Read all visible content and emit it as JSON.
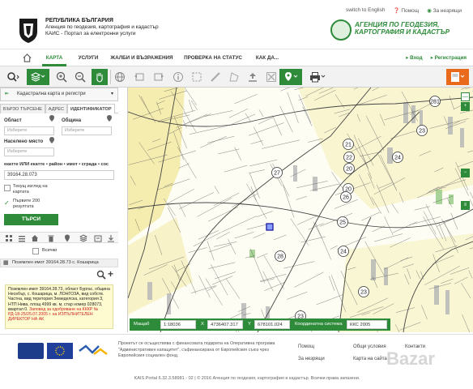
{
  "header": {
    "agency_line1": "РЕПУБЛИКА БЪЛГАРИЯ",
    "agency_line2": "Агенция по геодезия, картография и кадастър",
    "agency_line3": "КАИС - Портал за електронни услуги",
    "top_links": [
      "switch to English",
      "Помощ",
      "За незрящи"
    ],
    "logo_line1": "АГЕНЦИЯ ПО ГЕОДЕЗИЯ,",
    "logo_line2": "КАРТОГРАФИЯ И КАДАСТЪР"
  },
  "nav": {
    "items": [
      "КАРТА",
      "УСЛУГИ",
      "ЖАЛБИ И ВЪЗРАЖЕНИЯ",
      "ПРОВЕРКА НА СТАТУС",
      "КАК ДА..."
    ],
    "login": "Вход",
    "register": "Регистрация"
  },
  "panel": {
    "header": "Кадастрална карта и регистри",
    "tabs": [
      "БЪРЗО ТЪРСЕНЕ",
      "АДРЕС",
      "ИДЕНТИФИКАТОР"
    ],
    "region_label": "Област",
    "region_placeholder": "Изберете",
    "municipality_label": "Община",
    "municipality_placeholder": "Изберете",
    "settlement_label": "Населено място",
    "settlement_placeholder": "Изберете",
    "identifier_label": "екатте ИЛИ екатте • район • имот • сграда • сос",
    "identifier_value": "39164.28.073",
    "current_view_label": "Текущ изглед на картата",
    "first200_label": "Първите 200 резултата",
    "search_button": "ТЪРСИ",
    "all_label": "Всички",
    "result_text": "Поземлен имот 39164.28.73 с. Кошарица",
    "info_text": "Поземлен имот 39164.28.73, област Бургас, община Несебър, с. Кошарица, м. ЛОНГОЗА, вид собств. Частна, вид територия Земеделска, категория 3, НТП Нива, площ 4999 кв. м, стар номер 028073, квартал 0.",
    "info_red": "Заповед за одобряване на КККР № РД-18-25/25.07.2005 г. на ИЗПЪЛНИТЕЛЕН ДИРЕКТОР НА АК"
  },
  "map": {
    "parcel_numbers": [
      "281",
      "23",
      "24",
      "22",
      "21",
      "20",
      "27",
      "26",
      "25",
      "28",
      "23",
      "24",
      "23",
      "20"
    ]
  },
  "coordbar": {
    "scale_label": "Мащаб",
    "scale_value": "1:18036",
    "x_label": "X",
    "x_value": "4736407.317",
    "y_label": "Y",
    "y_value": "678101.024",
    "system_label": "Координатна система",
    "system_value": "ККС 2005"
  },
  "footer": {
    "project_text": "Проектът се осъществява с финансовата подкрепа на Оперативна програма \"Административен капацитет\", съфинансирана от Европейския съюз чрез Европейския социален фонд.",
    "links_col1": [
      "Помощ",
      "За незрящи"
    ],
    "links_col2": [
      "Общи условия",
      "Карта на сайта"
    ],
    "links_col3": [
      "Контакти"
    ],
    "copyright": "KAIS.Portal 6.32.3.58981 - 02 | © 2016 Агенция по геодезия, картография и кадастър. Всички права запазени.",
    "watermark": "Bazar"
  },
  "colors": {
    "brand_green": "#2e8b3a",
    "tool_orange": "#e86a1a",
    "info_yellow": "#fffbd0"
  }
}
